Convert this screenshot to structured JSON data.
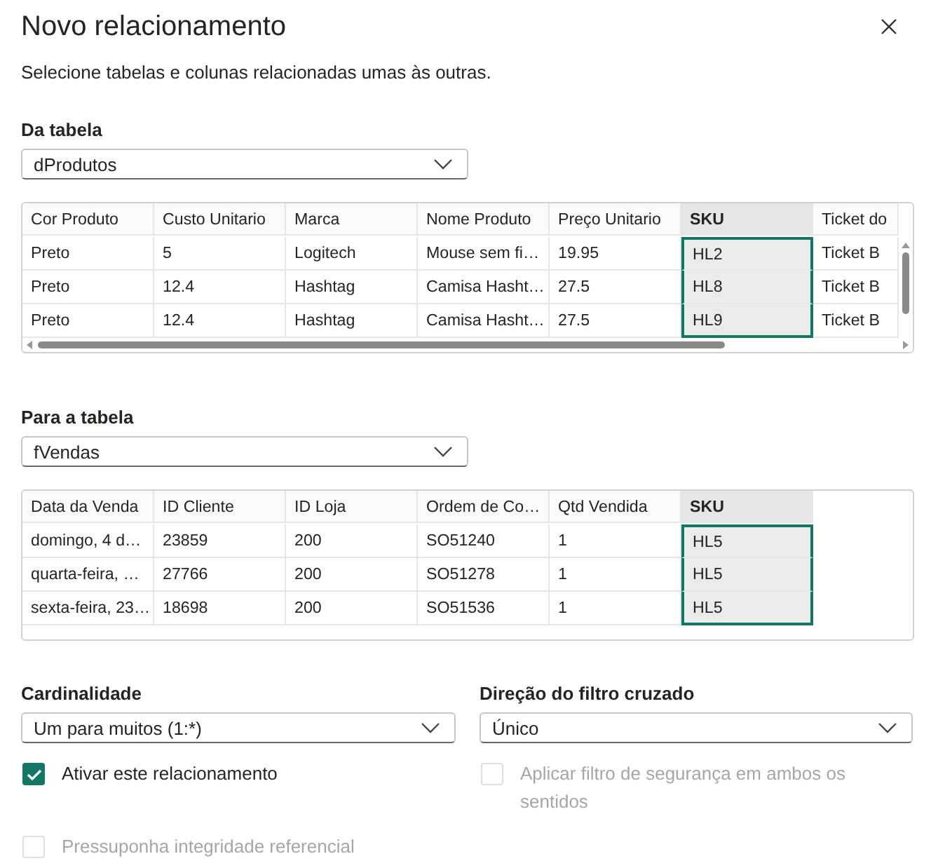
{
  "dialog": {
    "title": "Novo relacionamento",
    "subtitle": "Selecione tabelas e colunas relacionadas umas às outras."
  },
  "from_table": {
    "label": "Da tabela",
    "value": "dProdutos",
    "scrollbars": true,
    "columns": [
      {
        "label": "Cor Produto",
        "selected": false
      },
      {
        "label": "Custo Unitario",
        "selected": false
      },
      {
        "label": "Marca",
        "selected": false
      },
      {
        "label": "Nome Produto",
        "selected": false
      },
      {
        "label": "Preço Unitario",
        "selected": false
      },
      {
        "label": "SKU",
        "selected": true
      },
      {
        "label": "Ticket do",
        "selected": false
      }
    ],
    "rows": [
      [
        "Preto",
        "5",
        "Logitech",
        "Mouse sem fi…",
        "19.95",
        "HL2",
        "Ticket B"
      ],
      [
        "Preto",
        "12.4",
        "Hashtag",
        "Camisa Hasht…",
        "27.5",
        "HL8",
        "Ticket B"
      ],
      [
        "Preto",
        "12.4",
        "Hashtag",
        "Camisa Hasht…",
        "27.5",
        "HL9",
        "Ticket B"
      ]
    ]
  },
  "to_table": {
    "label": "Para a tabela",
    "value": "fVendas",
    "scrollbars": false,
    "columns": [
      {
        "label": "Data da Venda",
        "selected": false
      },
      {
        "label": "ID Cliente",
        "selected": false
      },
      {
        "label": "ID Loja",
        "selected": false
      },
      {
        "label": "Ordem de Co…",
        "selected": false
      },
      {
        "label": "Qtd Vendida",
        "selected": false
      },
      {
        "label": "SKU",
        "selected": true
      }
    ],
    "rows": [
      [
        "domingo, 4 d…",
        "23859",
        "200",
        "SO51240",
        "1",
        "HL5"
      ],
      [
        "quarta-feira, …",
        "27766",
        "200",
        "SO51278",
        "1",
        "HL5"
      ],
      [
        "sexta-feira, 23…",
        "18698",
        "200",
        "SO51536",
        "1",
        "HL5"
      ]
    ]
  },
  "cardinality": {
    "label": "Cardinalidade",
    "value": "Um para muitos (1:*)"
  },
  "cross_filter": {
    "label": "Direção do filtro cruzado",
    "value": "Único"
  },
  "options": [
    {
      "label": "Ativar este relacionamento",
      "checked": true,
      "disabled": false
    },
    {
      "label": "Aplicar filtro de segurança em ambos os sentidos",
      "checked": false,
      "disabled": true
    },
    {
      "label": "Pressuponha integridade referencial",
      "checked": false,
      "disabled": true
    }
  ]
}
